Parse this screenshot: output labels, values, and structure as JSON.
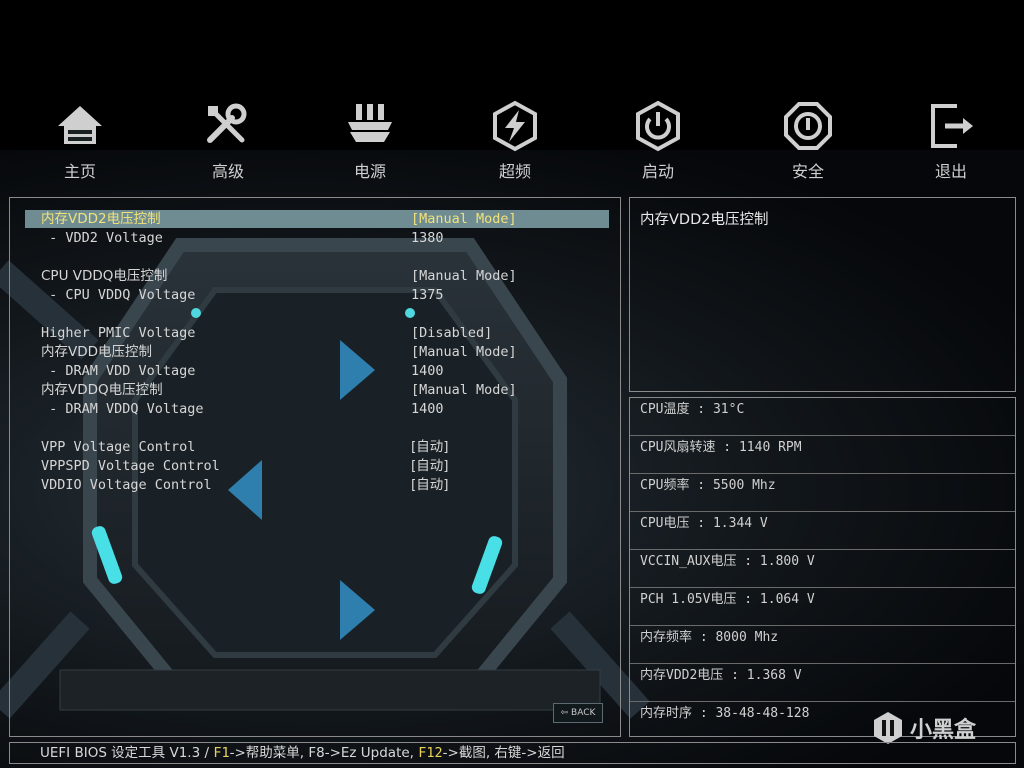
{
  "nav": [
    {
      "label": "主页",
      "icon": "home-icon"
    },
    {
      "label": "高级",
      "icon": "tools-icon"
    },
    {
      "label": "电源",
      "icon": "power-plug-icon"
    },
    {
      "label": "超频",
      "icon": "overclock-icon"
    },
    {
      "label": "启动",
      "icon": "power-button-icon"
    },
    {
      "label": "安全",
      "icon": "security-icon"
    },
    {
      "label": "退出",
      "icon": "exit-icon"
    }
  ],
  "settings": [
    {
      "label": "内存VDD2电压控制",
      "value": "[Manual Mode]",
      "selected": true
    },
    {
      "label": " - VDD2 Voltage",
      "value": "1380"
    },
    {
      "label": "CPU VDDQ电压控制",
      "value": "[Manual Mode]"
    },
    {
      "label": " - CPU VDDQ Voltage",
      "value": "1375"
    },
    {
      "label": "Higher PMIC Voltage",
      "value": "[Disabled]"
    },
    {
      "label": "内存VDD电压控制",
      "value": "[Manual Mode]"
    },
    {
      "label": " - DRAM VDD Voltage",
      "value": "1400"
    },
    {
      "label": "内存VDDQ电压控制",
      "value": "[Manual Mode]"
    },
    {
      "label": " - DRAM VDDQ Voltage",
      "value": "1400"
    },
    {
      "label": "VPP Voltage Control",
      "value": "[自动]"
    },
    {
      "label": "VPPSPD Voltage Control",
      "value": "[自动]"
    },
    {
      "label": "VDDIO Voltage Control",
      "value": "[自动]"
    }
  ],
  "help": {
    "text": "内存VDD2电压控制"
  },
  "status": [
    "CPU温度 : 31°C",
    "CPU风扇转速 : 1140 RPM",
    "CPU频率 : 5500 Mhz",
    "CPU电压 : 1.344 V",
    "VCCIN_AUX电压 : 1.800 V",
    "PCH 1.05V电压 : 1.064 V",
    "内存频率 : 8000 Mhz",
    "内存VDD2电压 : 1.368 V",
    "内存时序 : 38-48-48-128"
  ],
  "back_button": {
    "label": "BACK"
  },
  "footer": {
    "prefix": "UEFI BIOS 设定工具 V1.3 / ",
    "f1_key": "F1",
    "f1_text": "->帮助菜单, F8->Ez Update, ",
    "f12_key": "F12",
    "f12_text": "->截图, 右键->返回"
  },
  "watermark": {
    "text": "小黑盒"
  },
  "colors": {
    "accent": "#6f8c93",
    "highlight_text": "#f0e27a",
    "key_color": "#e8d25a"
  }
}
